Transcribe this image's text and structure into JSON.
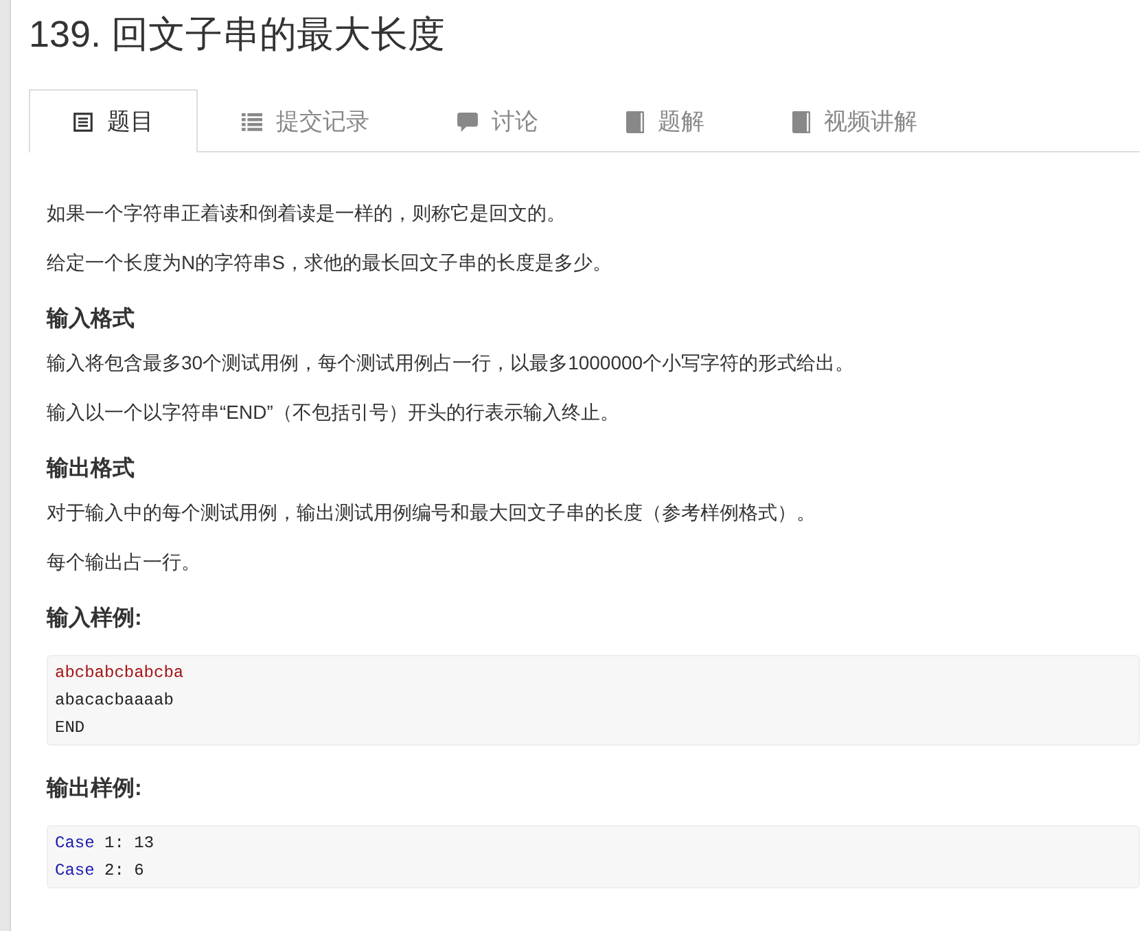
{
  "title": "139. 回文子串的最大长度",
  "tabs": [
    {
      "label": "题目",
      "selected": true
    },
    {
      "label": "提交记录",
      "selected": false
    },
    {
      "label": "讨论",
      "selected": false
    },
    {
      "label": "题解",
      "selected": false
    },
    {
      "label": "视频讲解",
      "selected": false
    }
  ],
  "content": [
    {
      "kind": "paragraph",
      "text": "如果一个字符串正着读和倒着读是一样的，则称它是回文的。"
    },
    {
      "kind": "paragraph",
      "text": "给定一个长度为N的字符串S，求他的最长回文子串的长度是多少。"
    },
    {
      "kind": "heading",
      "text": "输入格式"
    },
    {
      "kind": "paragraph",
      "text": "输入将包含最多30个测试用例，每个测试用例占一行，以最多1000000个小写字符的形式给出。"
    },
    {
      "kind": "paragraph",
      "text": "输入以一个以字符串“END”（不包括引号）开头的行表示输入终止。"
    },
    {
      "kind": "heading",
      "text": "输出格式"
    },
    {
      "kind": "paragraph",
      "text": "对于输入中的每个测试用例，输出测试用例编号和最大回文子串的长度（参考样例格式）。"
    },
    {
      "kind": "paragraph",
      "text": "每个输出占一行。"
    },
    {
      "kind": "heading",
      "text": "输入样例:"
    },
    {
      "kind": "code",
      "lines": [
        {
          "tokens": [
            {
              "kind": "string",
              "text": "abcbabcbabcba"
            }
          ]
        },
        {
          "tokens": [
            {
              "kind": "plain",
              "text": "abacacbaaaab"
            }
          ]
        },
        {
          "tokens": [
            {
              "kind": "plain",
              "text": "END"
            }
          ]
        }
      ]
    },
    {
      "kind": "heading",
      "text": "输出样例:"
    },
    {
      "kind": "code",
      "lines": [
        {
          "tokens": [
            {
              "kind": "keyword",
              "text": "Case"
            },
            {
              "kind": "plain",
              "text": " 1: 13"
            }
          ]
        },
        {
          "tokens": [
            {
              "kind": "keyword",
              "text": "Case"
            },
            {
              "kind": "plain",
              "text": " 2: 6"
            }
          ]
        }
      ]
    }
  ]
}
